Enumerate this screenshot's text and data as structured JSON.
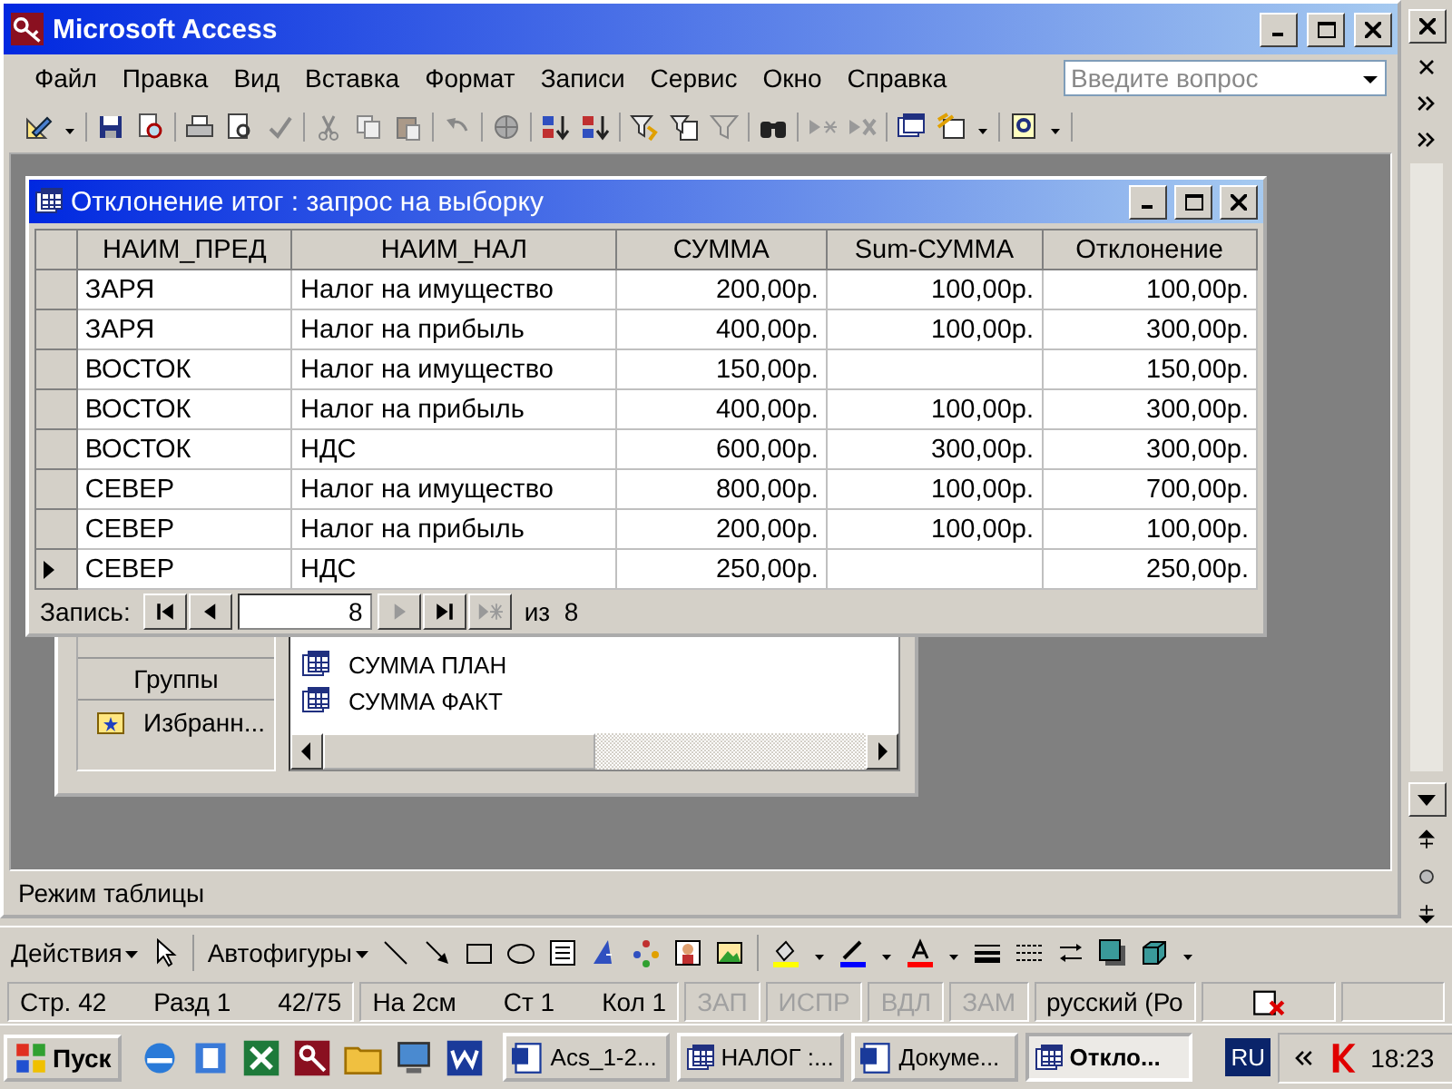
{
  "app_window": {
    "title": "Microsoft Access"
  },
  "menu": [
    "Файл",
    "Правка",
    "Вид",
    "Вставка",
    "Формат",
    "Записи",
    "Сервис",
    "Окно",
    "Справка"
  ],
  "help_search": {
    "placeholder": "Введите вопрос"
  },
  "query_window": {
    "title": "Отклонение итог : запрос на выборку",
    "columns": [
      "НАИМ_ПРЕД",
      "НАИМ_НАЛ",
      "СУММА",
      "Sum-СУММА",
      "Отклонение"
    ],
    "rows": [
      {
        "cells": [
          "ЗАРЯ",
          "Налог на имущество",
          "200,00р.",
          "100,00р.",
          "100,00р."
        ],
        "current": false
      },
      {
        "cells": [
          "ЗАРЯ",
          "Налог на прибыль",
          "400,00р.",
          "100,00р.",
          "300,00р."
        ],
        "current": false
      },
      {
        "cells": [
          "ВОСТОК",
          "Налог на имущество",
          "150,00р.",
          "",
          "150,00р."
        ],
        "current": false
      },
      {
        "cells": [
          "ВОСТОК",
          "Налог на прибыль",
          "400,00р.",
          "100,00р.",
          "300,00р."
        ],
        "current": false
      },
      {
        "cells": [
          "ВОСТОК",
          "НДС",
          "600,00р.",
          "300,00р.",
          "300,00р."
        ],
        "current": false
      },
      {
        "cells": [
          "СЕВЕР",
          "Налог на имущество",
          "800,00р.",
          "100,00р.",
          "700,00р."
        ],
        "current": false
      },
      {
        "cells": [
          "СЕВЕР",
          "Налог на прибыль",
          "200,00р.",
          "100,00р.",
          "100,00р."
        ],
        "current": false
      },
      {
        "cells": [
          "СЕВЕР",
          "НДС",
          "250,00р.",
          "",
          "250,00р."
        ],
        "current": true
      }
    ],
    "navigator": {
      "label": "Запись:",
      "value": "8",
      "total": "из  8",
      "buttons": [
        {
          "kind": "first",
          "disabled": false
        },
        {
          "kind": "prev",
          "disabled": false
        },
        {
          "kind": "next",
          "disabled": true
        },
        {
          "kind": "last",
          "disabled": false
        },
        {
          "kind": "new",
          "disabled": true
        }
      ]
    }
  },
  "database_window": {
    "groups": [
      {
        "kind": "header",
        "label": "Группы"
      },
      {
        "kind": "item",
        "label": "Избранн..."
      }
    ],
    "objects": [
      "СУММА ПЛАН",
      "СУММА ФАКТ"
    ]
  },
  "status_bar": "Режим таблицы",
  "drawing_toolbar": {
    "actions": "Действия",
    "autoshapes": "Автофигуры"
  },
  "word_status": [
    {
      "items": [
        "Стр. 42",
        "Разд 1",
        "42/75"
      ],
      "disabled": false
    },
    {
      "items": [
        "На 2см",
        "Ст 1",
        "Кол 1"
      ],
      "disabled": false
    },
    {
      "items": [
        "ЗАП"
      ],
      "disabled": true
    },
    {
      "items": [
        "ИСПР"
      ],
      "disabled": true
    },
    {
      "items": [
        "ВДЛ"
      ],
      "disabled": true
    },
    {
      "items": [
        "ЗАМ"
      ],
      "disabled": true
    },
    {
      "items": [
        "русский (Ро"
      ],
      "disabled": false
    }
  ],
  "taskbar": {
    "start": "Пуск",
    "tasks": [
      {
        "label": "Acs_1-2...",
        "kind": "document",
        "selected": false
      },
      {
        "label": "НАЛОГ :...",
        "kind": "database",
        "selected": false
      },
      {
        "label": "Докуме...",
        "kind": "document",
        "selected": false
      },
      {
        "label": "Откло...",
        "kind": "query",
        "selected": true
      }
    ],
    "language": "RU",
    "clock": "18:23"
  }
}
